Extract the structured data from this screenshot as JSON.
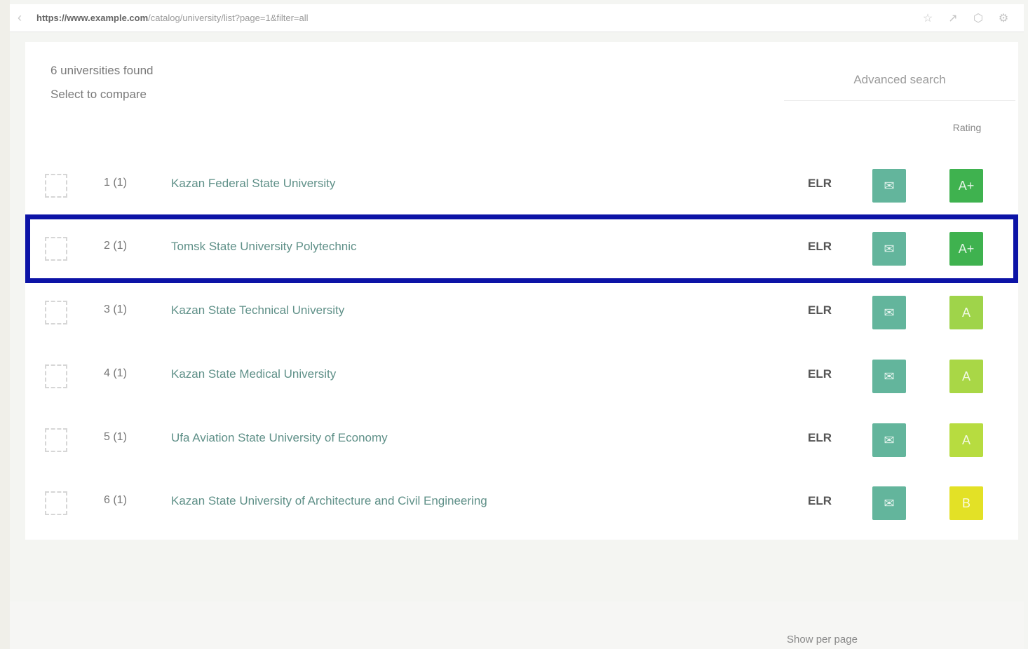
{
  "browser": {
    "url_host": "https://www.example.com",
    "url_path": "/catalog/university/list?page=1&filter=all",
    "back_icon": "back-arrow-icon",
    "actions": [
      "bookmark-icon",
      "share-icon",
      "extension-icon",
      "settings-icon"
    ]
  },
  "header": {
    "found_line1": "6 universities found",
    "found_line2": "Select to compare",
    "advanced_search": "Advanced search"
  },
  "table": {
    "rating_header": "Rating",
    "rows": [
      {
        "num": "1 (1)",
        "name": "Kazan Federal State University",
        "lang": "ELR",
        "action_icon": "envelope-icon",
        "rating": "A+",
        "rating_color": "#3fb24f"
      },
      {
        "num": "2 (1)",
        "name": "Tomsk State University Polytechnic",
        "lang": "ELR",
        "action_icon": "envelope-icon",
        "rating": "A+",
        "rating_color": "#3fb24f"
      },
      {
        "num": "3 (1)",
        "name": "Kazan State Technical University",
        "lang": "ELR",
        "action_icon": "envelope-icon",
        "rating": "A",
        "rating_color": "#9fd44a"
      },
      {
        "num": "4 (1)",
        "name": "Kazan State Medical University",
        "lang": "ELR",
        "action_icon": "envelope-icon",
        "rating": "A",
        "rating_color": "#a9d746"
      },
      {
        "num": "5 (1)",
        "name": "Ufa Aviation State University of Economy",
        "lang": "ELR",
        "action_icon": "envelope-icon",
        "rating": "A",
        "rating_color": "#b7dc40"
      },
      {
        "num": "6 (1)",
        "name": "Kazan State University of Architecture and Civil Engineering",
        "lang": "ELR",
        "action_icon": "envelope-icon",
        "rating": "B",
        "rating_color": "#e3e126"
      }
    ]
  },
  "footer": {
    "text": "Show per page"
  },
  "colors": {
    "highlight": "#0c13a6",
    "action_button": "#63b59c"
  }
}
